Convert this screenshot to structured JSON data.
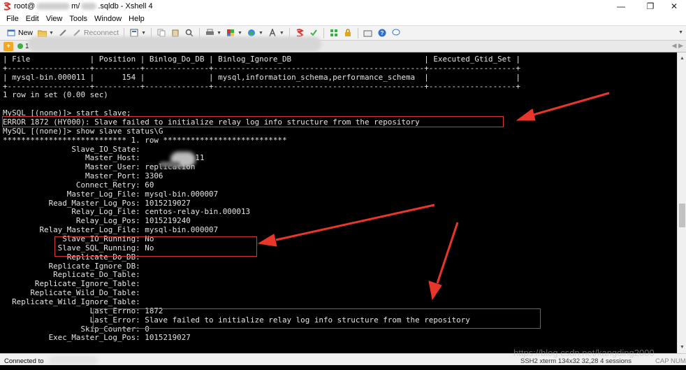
{
  "window": {
    "title_prefix": "root@",
    "title_mid": "m/",
    "title_suffix": ".sqldb - Xshell 4",
    "controls": {
      "minimize": "—",
      "maximize": "❐",
      "close": "✕"
    }
  },
  "menu": [
    "File",
    "Edit",
    "View",
    "Tools",
    "Window",
    "Help"
  ],
  "toolbar": {
    "new_label": "New",
    "reconnect_label": "Reconnect"
  },
  "tab": {
    "icon_label": "+",
    "label": "1"
  },
  "terminal": {
    "lines": [
      "| File             | Position | Binlog_Do_DB | Binlog_Ignore_DB                             | Executed_Gtid_Set |",
      "+------------------+----------+--------------+----------------------------------------------+-------------------+",
      "| mysql-bin.000011 |      154 |              | mysql,information_schema,performance_schema  |                   |",
      "+------------------+----------+--------------+----------------------------------------------+-------------------+",
      "1 row in set (0.00 sec)",
      "",
      "MySQL [(none)]> start slave;",
      "ERROR 1872 (HY000): Slave failed to initialize relay log info structure from the repository",
      "MySQL [(none)]> show slave status\\G",
      "*************************** 1. row ***************************",
      "               Slave_IO_State: ",
      "                  Master_Host:            11",
      "                  Master_User: replication",
      "                  Master_Port: 3306",
      "                Connect_Retry: 60",
      "              Master_Log_File: mysql-bin.000007",
      "          Read_Master_Log_Pos: 1015219027",
      "               Relay_Log_File: centos-relay-bin.000013",
      "                Relay_Log_Pos: 1015219240",
      "        Relay_Master_Log_File: mysql-bin.000007",
      "             Slave_IO_Running: No",
      "            Slave_SQL_Running: No",
      "              Replicate_Do_DB: ",
      "          Replicate_Ignore_DB: ",
      "           Replicate_Do_Table: ",
      "       Replicate_Ignore_Table: ",
      "      Replicate_Wild_Do_Table: ",
      "  Replicate_Wild_Ignore_Table: ",
      "                   Last_Errno: 1872",
      "                   Last_Error: Slave failed to initialize relay log info structure from the repository",
      "                 Skip_Counter: 0",
      "          Exec_Master_Log_Pos: 1015219027"
    ]
  },
  "status": {
    "left": "Connected to",
    "right": "SSH2  xterm  134x32  32,28  4 sessions",
    "caps": "CAP  NUM"
  },
  "watermark": "https://blog.csdn.net/kangding2000",
  "colors": {
    "terminal_bg": "#000000",
    "terminal_fg": "#e4e4e4",
    "highlight": "#d23a2e",
    "arrow": "#e8362a"
  }
}
